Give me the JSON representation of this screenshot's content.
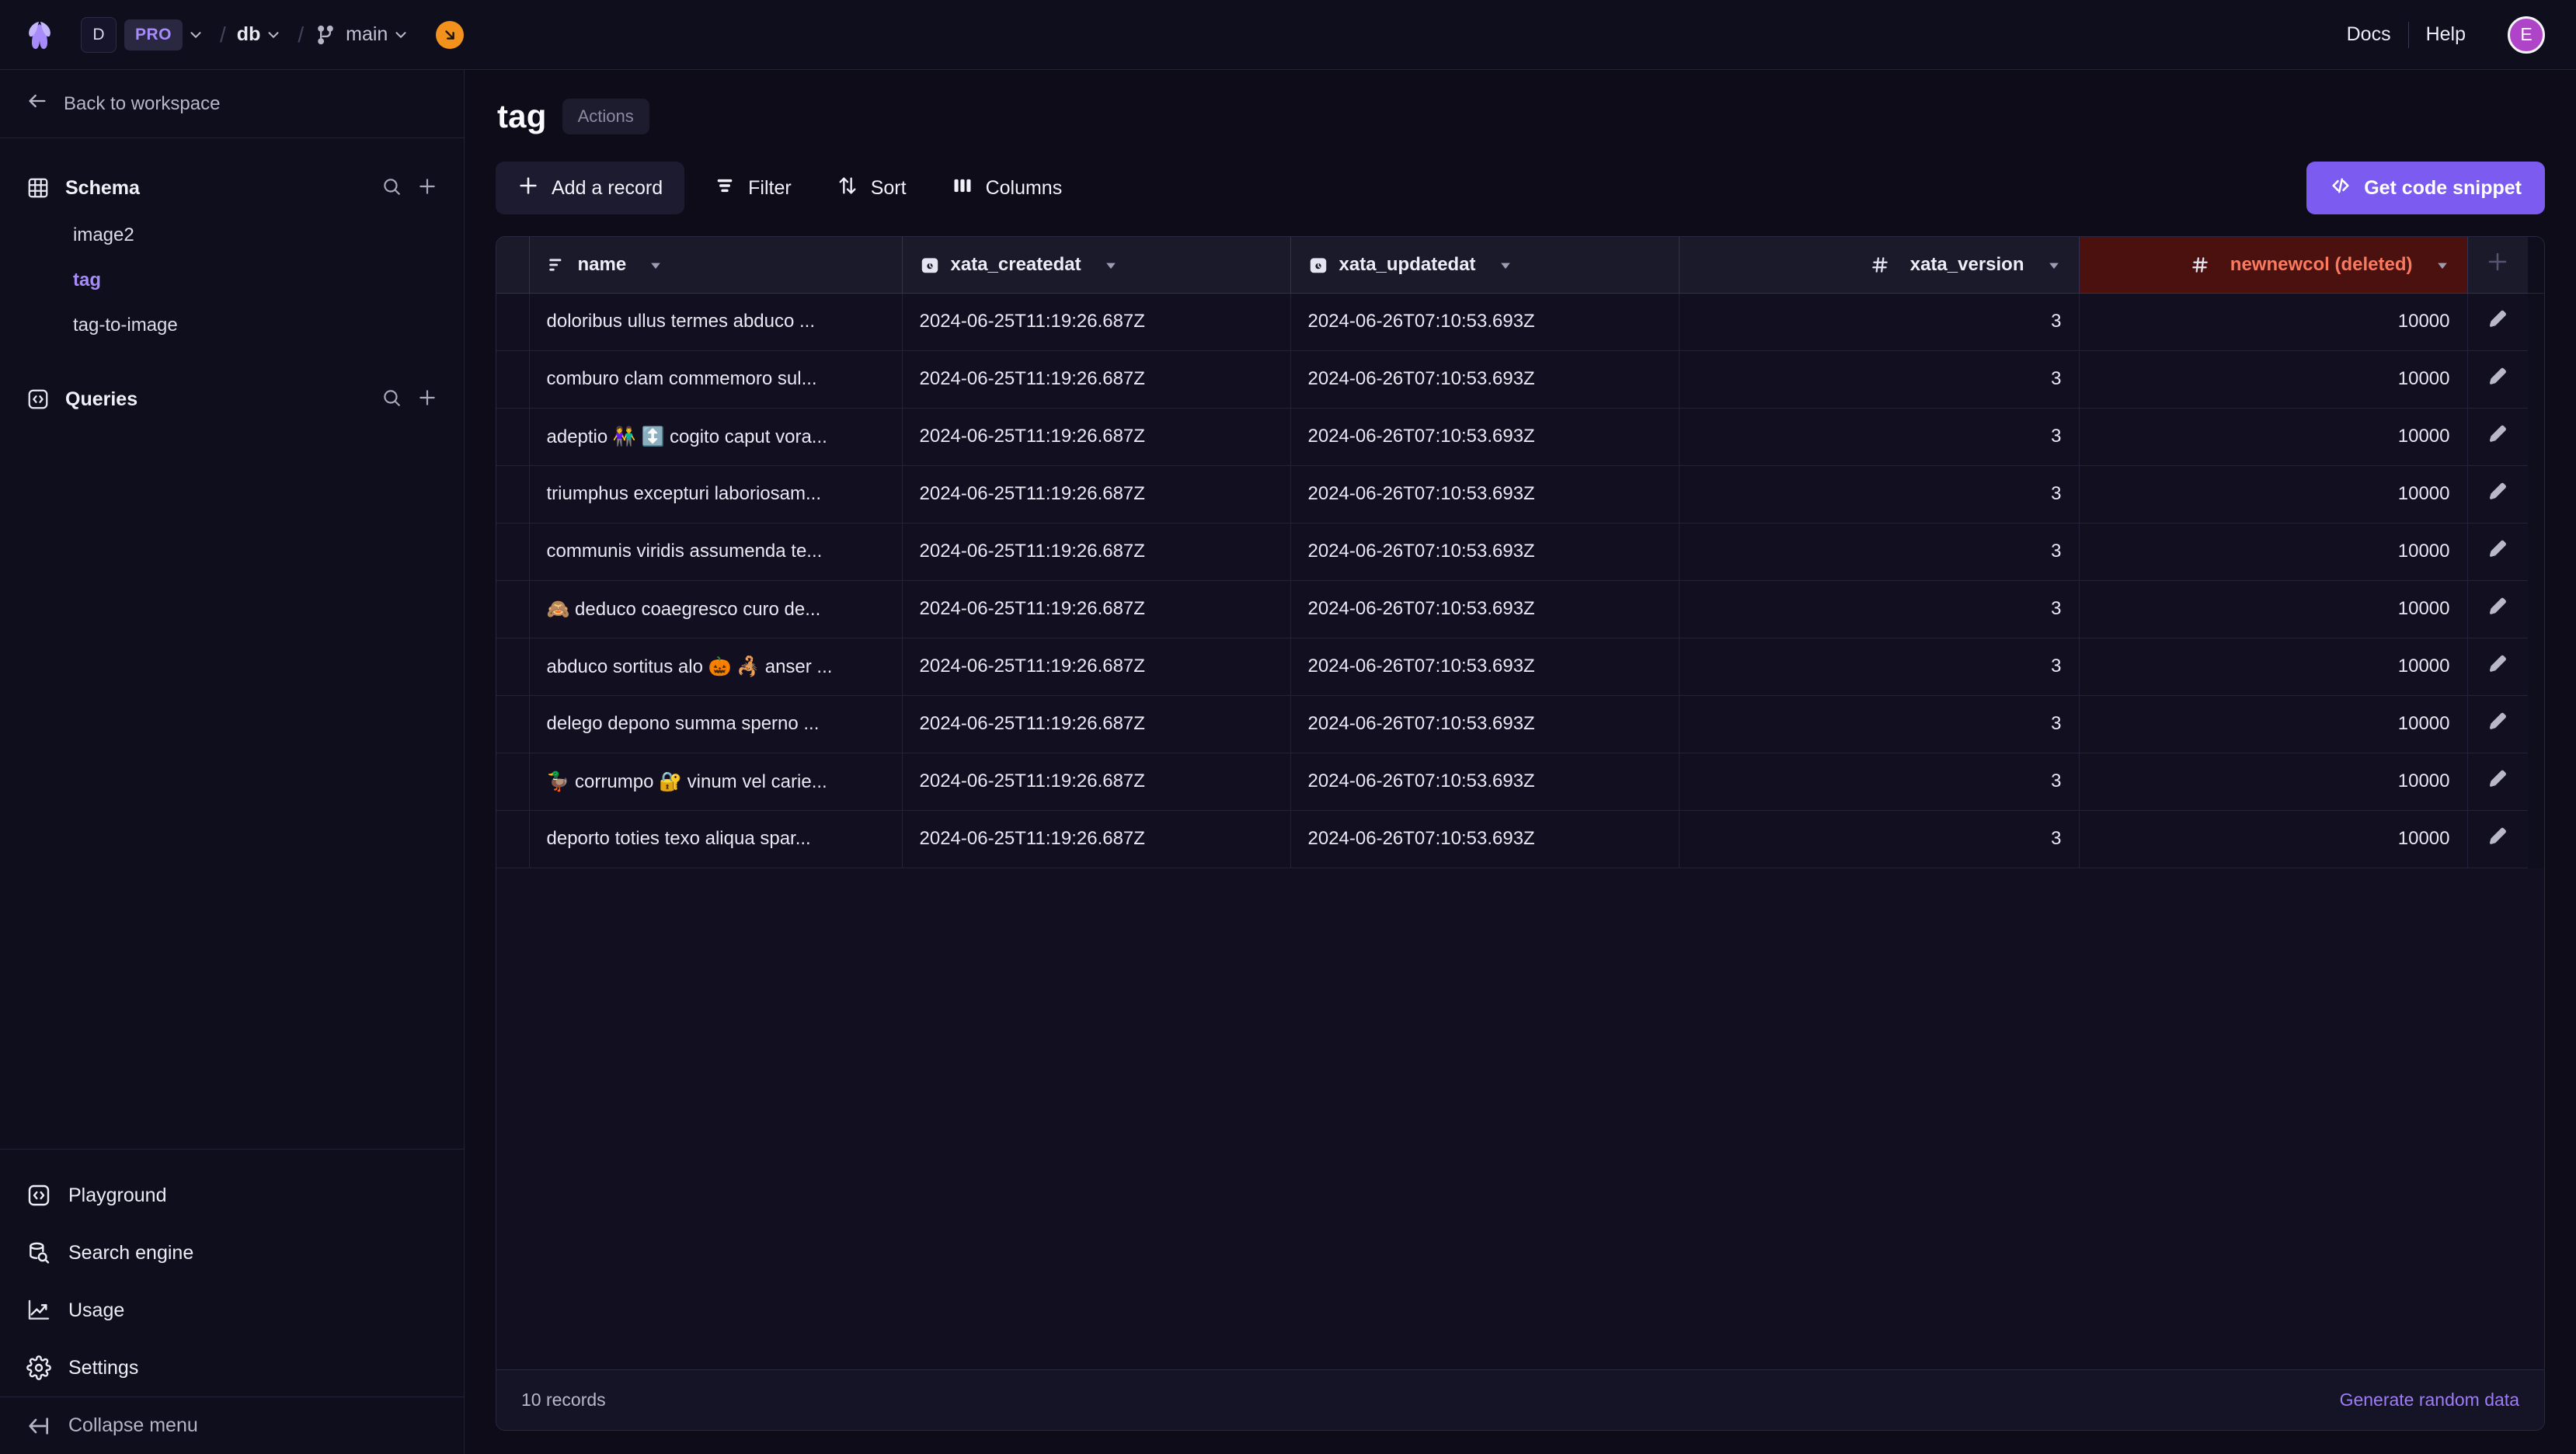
{
  "topbar": {
    "logo_icon": "xata-butterfly-logo",
    "org_initial": "D",
    "plan_badge": "PRO",
    "separator": "/",
    "database": "db",
    "branch": "main",
    "branch_icon": "git-branch-icon",
    "status_badge_icon": "arrow-down-right-circle-icon",
    "docs_label": "Docs",
    "help_label": "Help",
    "avatar_initial": "E"
  },
  "sidebar": {
    "back_label": "Back to workspace",
    "back_icon": "arrow-left-icon",
    "schema": {
      "label": "Schema",
      "icon": "table-grid-icon",
      "search_icon": "search-icon",
      "add_icon": "plus-icon",
      "tables": [
        {
          "label": "image2",
          "active": false
        },
        {
          "label": "tag",
          "active": true
        },
        {
          "label": "tag-to-image",
          "active": false
        }
      ]
    },
    "queries": {
      "label": "Queries",
      "icon": "code-brackets-icon",
      "search_icon": "search-icon",
      "add_icon": "plus-icon"
    },
    "nav": [
      {
        "label": "Playground",
        "icon": "code-brackets-icon"
      },
      {
        "label": "Search engine",
        "icon": "database-search-icon"
      },
      {
        "label": "Usage",
        "icon": "chart-line-up-icon"
      },
      {
        "label": "Settings",
        "icon": "gear-icon"
      }
    ],
    "collapse": {
      "label": "Collapse menu",
      "icon": "collapse-left-icon"
    }
  },
  "page": {
    "title": "tag",
    "actions_label": "Actions"
  },
  "toolbar": {
    "add_record_label": "Add a record",
    "add_record_icon": "plus-icon",
    "filter_label": "Filter",
    "filter_icon": "filter-icon",
    "sort_label": "Sort",
    "sort_icon": "sort-arrows-icon",
    "columns_label": "Columns",
    "columns_icon": "columns-icon",
    "snippet_label": "Get code snippet",
    "snippet_icon": "code-brackets-icon"
  },
  "table": {
    "columns": [
      {
        "key": "name",
        "label": "name",
        "icon": "text-lines-icon",
        "align": "left",
        "deleted": false
      },
      {
        "key": "xata_createdat",
        "label": "xata_createdat",
        "icon": "datetime-clock-icon",
        "align": "left",
        "deleted": false
      },
      {
        "key": "xata_updatedat",
        "label": "xata_updatedat",
        "icon": "datetime-clock-icon",
        "align": "left",
        "deleted": false
      },
      {
        "key": "xata_version",
        "label": "xata_version",
        "icon": "hash-icon",
        "align": "right",
        "deleted": false
      },
      {
        "key": "newnewcol",
        "label": "newnewcol (deleted)",
        "icon": "hash-icon",
        "align": "right",
        "deleted": true
      }
    ],
    "add_column_icon": "plus-icon",
    "dropdown_icon": "caret-down-icon",
    "edit_row_icon": "pencil-icon",
    "rows": [
      {
        "name": "doloribus ullus termes abduco ...",
        "xata_createdat": "2024-06-25T11:19:26.687Z",
        "xata_updatedat": "2024-06-26T07:10:53.693Z",
        "xata_version": "3",
        "newnewcol": "10000"
      },
      {
        "name": "comburo clam commemoro sul...",
        "xata_createdat": "2024-06-25T11:19:26.687Z",
        "xata_updatedat": "2024-06-26T07:10:53.693Z",
        "xata_version": "3",
        "newnewcol": "10000"
      },
      {
        "name": "adeptio 👫 ↕️ cogito caput vora...",
        "xata_createdat": "2024-06-25T11:19:26.687Z",
        "xata_updatedat": "2024-06-26T07:10:53.693Z",
        "xata_version": "3",
        "newnewcol": "10000"
      },
      {
        "name": "triumphus excepturi laboriosam...",
        "xata_createdat": "2024-06-25T11:19:26.687Z",
        "xata_updatedat": "2024-06-26T07:10:53.693Z",
        "xata_version": "3",
        "newnewcol": "10000"
      },
      {
        "name": "communis viridis assumenda te...",
        "xata_createdat": "2024-06-25T11:19:26.687Z",
        "xata_updatedat": "2024-06-26T07:10:53.693Z",
        "xata_version": "3",
        "newnewcol": "10000"
      },
      {
        "name": "🙈 deduco coaegresco curo de...",
        "xata_createdat": "2024-06-25T11:19:26.687Z",
        "xata_updatedat": "2024-06-26T07:10:53.693Z",
        "xata_version": "3",
        "newnewcol": "10000"
      },
      {
        "name": "abduco sortitus alo 🎃 🦂 anser ...",
        "xata_createdat": "2024-06-25T11:19:26.687Z",
        "xata_updatedat": "2024-06-26T07:10:53.693Z",
        "xata_version": "3",
        "newnewcol": "10000"
      },
      {
        "name": "delego depono summa sperno ...",
        "xata_createdat": "2024-06-25T11:19:26.687Z",
        "xata_updatedat": "2024-06-26T07:10:53.693Z",
        "xata_version": "3",
        "newnewcol": "10000"
      },
      {
        "name": "🦆 corrumpo 🔐 vinum vel carie...",
        "xata_createdat": "2024-06-25T11:19:26.687Z",
        "xata_updatedat": "2024-06-26T07:10:53.693Z",
        "xata_version": "3",
        "newnewcol": "10000"
      },
      {
        "name": "deporto toties texo aliqua spar...",
        "xata_createdat": "2024-06-25T11:19:26.687Z",
        "xata_updatedat": "2024-06-26T07:10:53.693Z",
        "xata_version": "3",
        "newnewcol": "10000"
      }
    ],
    "footer": {
      "record_count_label": "10 records",
      "generate_label": "Generate random data"
    }
  },
  "colors": {
    "accent_purple": "#7c5cf0",
    "link_purple": "#9d7cf5",
    "deleted_header_bg": "#4a110f",
    "deleted_header_text": "#fb7a5e",
    "badge_orange": "#f2921d",
    "avatar_magenta": "#b044c9",
    "page_bg": "#0d0c18"
  }
}
